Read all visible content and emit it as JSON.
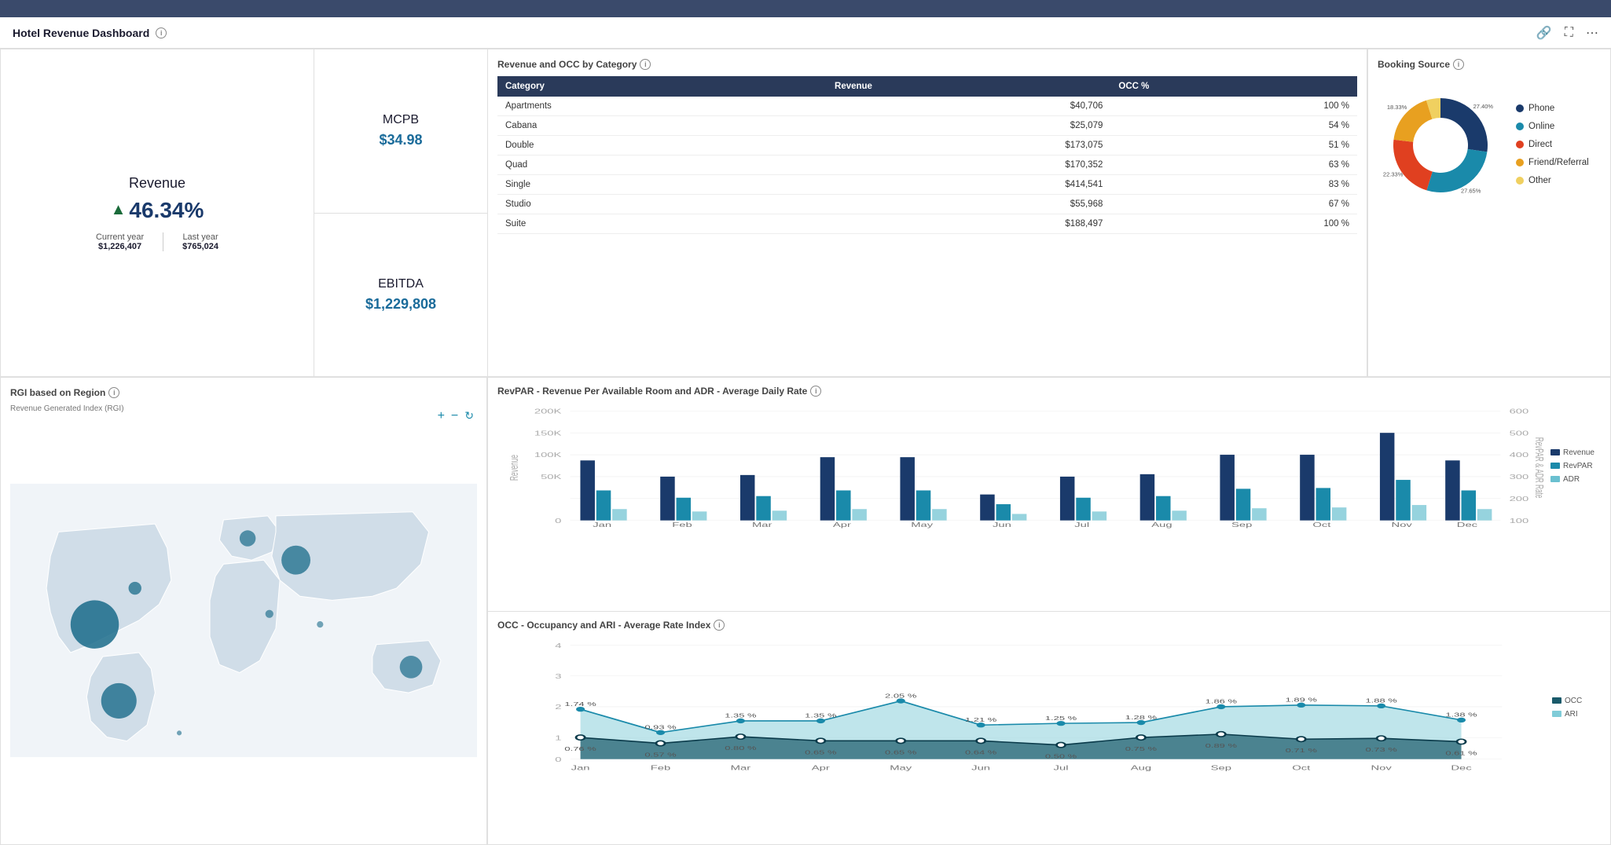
{
  "header": {
    "title": "Hotel Revenue Dashboard",
    "icons": [
      "link-icon",
      "expand-icon",
      "more-icon"
    ]
  },
  "revenue": {
    "label": "Revenue",
    "pct_change": "46.34%",
    "current_year_label": "Current year",
    "last_year_label": "Last year",
    "current_year_value": "$1,226,407",
    "last_year_value": "$765,024"
  },
  "mcpb": {
    "label": "MCPB",
    "value": "$34.98"
  },
  "ebitda": {
    "label": "EBITDA",
    "value": "$1,229,808"
  },
  "category_table": {
    "title": "Revenue and OCC by Category",
    "columns": [
      "Category",
      "Revenue",
      "OCC %"
    ],
    "rows": [
      {
        "category": "Apartments",
        "revenue": "$40,706",
        "occ": "100 %"
      },
      {
        "category": "Cabana",
        "revenue": "$25,079",
        "occ": "54 %"
      },
      {
        "category": "Double",
        "revenue": "$173,075",
        "occ": "51 %"
      },
      {
        "category": "Quad",
        "revenue": "$170,352",
        "occ": "63 %"
      },
      {
        "category": "Single",
        "revenue": "$414,541",
        "occ": "83 %"
      },
      {
        "category": "Studio",
        "revenue": "$55,968",
        "occ": "67 %"
      },
      {
        "category": "Suite",
        "revenue": "$188,497",
        "occ": "100 %"
      }
    ]
  },
  "booking_source": {
    "title": "Booking Source",
    "segments": [
      {
        "label": "Phone",
        "pct": 27.4,
        "color": "#1a3a6b",
        "border": "#1a3a6b"
      },
      {
        "label": "Online",
        "pct": 27.65,
        "color": "#1a8aaa",
        "border": "#1a8aaa"
      },
      {
        "label": "Direct",
        "pct": 22.33,
        "color": "#e04020",
        "border": "#e04020"
      },
      {
        "label": "Friend/Referral",
        "pct": 18.33,
        "color": "#e8a020",
        "border": "#e8a020"
      },
      {
        "label": "Other",
        "pct": 4.89,
        "color": "#f0d060",
        "border": "#f0d060"
      }
    ],
    "labels": {
      "phone_pct": "27.4%",
      "online_pct": "27.65%",
      "direct_pct": "22.33%",
      "referral_pct": "18.33%",
      "other_pct": "4.89%"
    }
  },
  "rgi": {
    "title": "RGI based on Region",
    "subtitle": "Revenue Generated Index (RGI)"
  },
  "revpar": {
    "title": "RevPAR - Revenue Per Available Room and ADR - Average Daily Rate",
    "months": [
      "Jan",
      "Feb",
      "Mar",
      "Apr",
      "May",
      "Jun",
      "Jul",
      "Aug",
      "Sep",
      "Oct",
      "Nov",
      "Dec"
    ],
    "revenue_vals": [
      110,
      80,
      82,
      115,
      115,
      47,
      78,
      80,
      120,
      120,
      160,
      110
    ],
    "revpar_vals": [
      55,
      42,
      45,
      55,
      55,
      30,
      42,
      45,
      58,
      60,
      75,
      55
    ],
    "adr_vals": [
      20,
      16,
      18,
      20,
      20,
      12,
      16,
      18,
      22,
      22,
      28,
      20
    ],
    "legend": [
      "Revenue",
      "RevPAR",
      "ADR"
    ]
  },
  "occ_ari": {
    "title": "OCC - Occupancy and ARI - Average Rate Index",
    "months": [
      "Jan",
      "Feb",
      "Mar",
      "Apr",
      "May",
      "Jun",
      "Jul",
      "Aug",
      "Sep",
      "Oct",
      "Nov",
      "Dec"
    ],
    "occ_vals": [
      0.76,
      0.57,
      0.8,
      0.65,
      0.65,
      0.64,
      0.5,
      0.75,
      0.89,
      0.71,
      0.73,
      0.61
    ],
    "ari_vals": [
      1.74,
      0.93,
      1.35,
      1.35,
      2.05,
      1.21,
      1.25,
      1.28,
      1.86,
      1.89,
      1.88,
      1.38
    ],
    "occ_label": "OCC",
    "ari_label": "ARI"
  }
}
